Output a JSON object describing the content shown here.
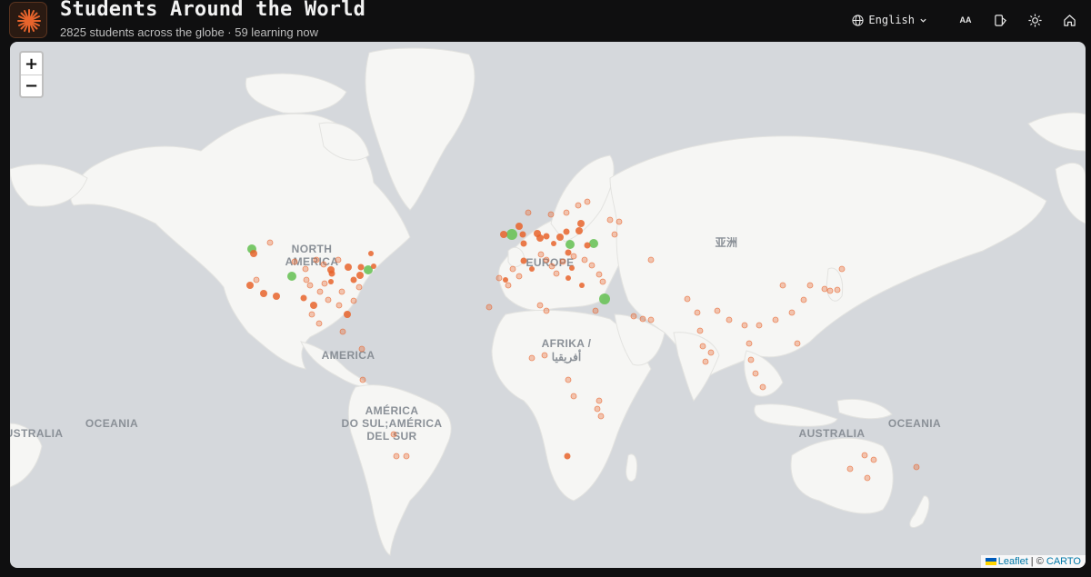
{
  "header": {
    "title": "Students Around the World",
    "subtitle": "2825 students across the globe · 59 learning now",
    "language": "English",
    "text_size_label": "AA"
  },
  "map": {
    "zoom_in": "+",
    "zoom_out": "−",
    "labels": {
      "north_america_1": "NORTH",
      "north_america_2": "AMERICA",
      "america": "AMERICA",
      "south_america_1": "AMÉRICA",
      "south_america_2": "DO SUL;AMÉRICA",
      "south_america_3": "DEL SUR",
      "europe": "EUROPE",
      "africa_1": "AFRIKA /",
      "africa_2": "أفريقيا",
      "asia": "亚洲",
      "oceania_left": "OCEANIA",
      "oceania_right": "OCEANIA",
      "australia_left": "AUSTRALIA",
      "australia_right": "AUSTRALIA"
    },
    "attribution": {
      "leaflet": "Leaflet",
      "separator": " | © ",
      "carto": "CARTO"
    }
  },
  "colors": {
    "accent": "#e8642c",
    "learning_now": "#6cc35a",
    "ocean": "#d5d8dc",
    "land": "#f6f6f4",
    "header_bg": "#0f0f10"
  },
  "icons": {
    "logo": "starburst-icon",
    "language": "globe-icon",
    "dropdown": "chevron-down-icon",
    "contrast": "contrast-icon",
    "theme": "sun-icon",
    "home": "home-icon"
  }
}
